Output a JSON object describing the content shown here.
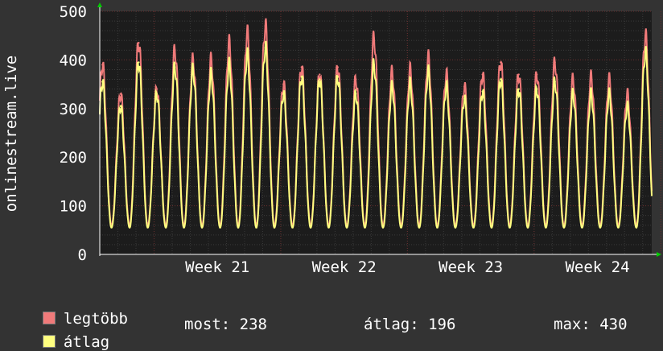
{
  "chart_data": {
    "type": "line",
    "ylabel": "onlinestream.live",
    "ylim": [
      0,
      500
    ],
    "yticks": [
      0,
      100,
      200,
      300,
      400,
      500
    ],
    "xlim_days": [
      0,
      30.5
    ],
    "week_ticks": [
      {
        "label": "Week 21",
        "day": 6.5
      },
      {
        "label": "Week 22",
        "day": 13.5
      },
      {
        "label": "Week 23",
        "day": 20.5
      },
      {
        "label": "Week 24",
        "day": 27.5
      }
    ],
    "daily_peaks": [
      {
        "day": 0.15,
        "max": 390,
        "avg": 355
      },
      {
        "day": 1.15,
        "max": 330,
        "avg": 305
      },
      {
        "day": 2.15,
        "max": 435,
        "avg": 395
      },
      {
        "day": 3.15,
        "max": 340,
        "avg": 330
      },
      {
        "day": 4.15,
        "max": 420,
        "avg": 385
      },
      {
        "day": 5.15,
        "max": 400,
        "avg": 380
      },
      {
        "day": 6.15,
        "max": 400,
        "avg": 370
      },
      {
        "day": 7.15,
        "max": 435,
        "avg": 390
      },
      {
        "day": 8.15,
        "max": 455,
        "avg": 410
      },
      {
        "day": 9.15,
        "max": 470,
        "avg": 425
      },
      {
        "day": 10.15,
        "max": 350,
        "avg": 330
      },
      {
        "day": 11.15,
        "max": 385,
        "avg": 365
      },
      {
        "day": 12.15,
        "max": 370,
        "avg": 360
      },
      {
        "day": 13.15,
        "max": 385,
        "avg": 365
      },
      {
        "day": 14.15,
        "max": 360,
        "avg": 330
      },
      {
        "day": 15.15,
        "max": 445,
        "avg": 390
      },
      {
        "day": 16.15,
        "max": 375,
        "avg": 345
      },
      {
        "day": 17.15,
        "max": 380,
        "avg": 350
      },
      {
        "day": 18.15,
        "max": 405,
        "avg": 375
      },
      {
        "day": 19.15,
        "max": 370,
        "avg": 345
      },
      {
        "day": 20.15,
        "max": 345,
        "avg": 320
      },
      {
        "day": 21.15,
        "max": 370,
        "avg": 335
      },
      {
        "day": 22.15,
        "max": 395,
        "avg": 360
      },
      {
        "day": 23.15,
        "max": 370,
        "avg": 340
      },
      {
        "day": 24.15,
        "max": 370,
        "avg": 340
      },
      {
        "day": 25.15,
        "max": 395,
        "avg": 355
      },
      {
        "day": 26.15,
        "max": 360,
        "avg": 330
      },
      {
        "day": 27.15,
        "max": 365,
        "avg": 330
      },
      {
        "day": 28.15,
        "max": 360,
        "avg": 330
      },
      {
        "day": 29.15,
        "max": 330,
        "avg": 305
      },
      {
        "day": 30.15,
        "max": 450,
        "avg": 415
      }
    ],
    "daily_min": {
      "max": 60,
      "avg": 55
    },
    "series": [
      {
        "name": "legtöbb",
        "color": "#f07a7a"
      },
      {
        "name": "átlag",
        "color": "#ffff80"
      }
    ],
    "grid": true
  },
  "legend": {
    "max_label": "legtöbb",
    "avg_label": "átlag",
    "current": "most: 238",
    "average": "átlag: 196",
    "maximum": "max: 430"
  }
}
